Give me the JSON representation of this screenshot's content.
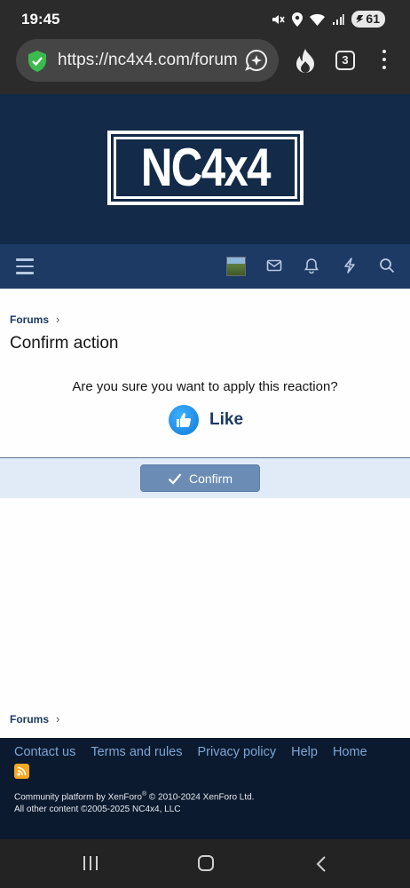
{
  "status_bar": {
    "time": "19:45",
    "battery": "61"
  },
  "browser": {
    "url": "https://nc4x4.com/forum",
    "tab_count": "3"
  },
  "site": {
    "logo_text": "NC4x4"
  },
  "breadcrumb": {
    "label": "Forums"
  },
  "page": {
    "title": "Confirm action",
    "question": "Are you sure you want to apply this reaction?",
    "reaction_label": "Like",
    "confirm_label": "Confirm"
  },
  "footer": {
    "links": [
      "Contact us",
      "Terms and rules",
      "Privacy policy",
      "Help",
      "Home"
    ],
    "copyright_line1_prefix": "Community platform by XenForo",
    "copyright_reg": "®",
    "copyright_line1_suffix": " © 2010-2024 XenForo Ltd.",
    "copyright_line2": "All other content ©2005-2025 NC4x4, LLC"
  },
  "colors": {
    "header_bg": "#132a48",
    "nav_bg": "#1c3a63",
    "button_bg": "#6b8db5",
    "footer_bg": "#0b1a2e",
    "link": "#7ea6d6"
  }
}
